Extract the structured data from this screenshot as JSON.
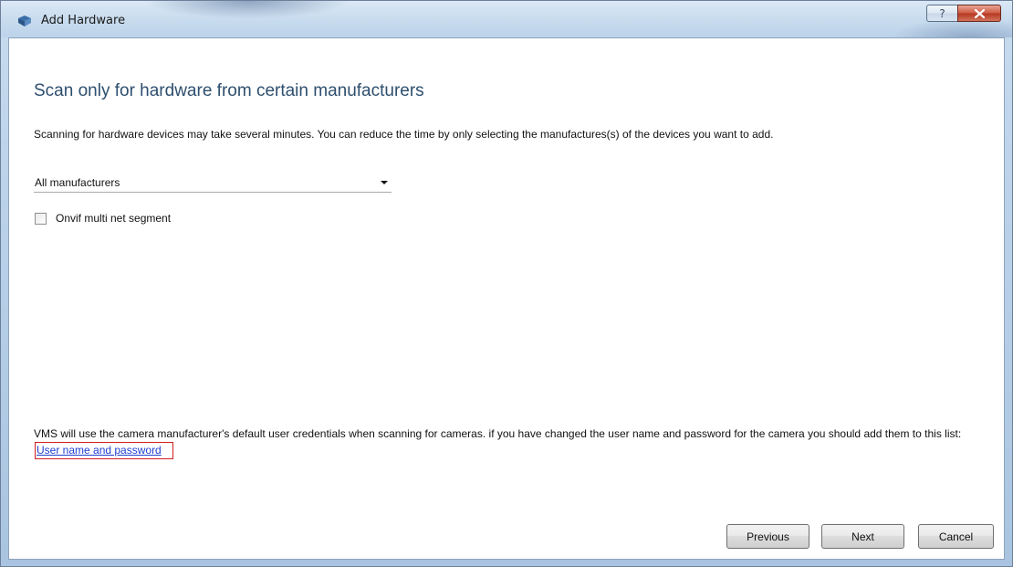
{
  "window": {
    "title": "Add Hardware",
    "icons": {
      "app": "add-hardware-icon",
      "help": "help-icon",
      "close": "close-icon"
    },
    "help_glyph": "?"
  },
  "heading": "Scan only for hardware from certain manufacturers",
  "intro": "Scanning for hardware devices may take several minutes. You can reduce the time by only selecting the manufactures(s) of the devices you want to add.",
  "manufacturer_select": {
    "value": "All manufacturers"
  },
  "onvif_checkbox": {
    "label": "Onvif multi net segment",
    "checked": false
  },
  "credentials_note": {
    "text": "VMS will use the camera manufacturer's default user credentials when scanning for cameras. if you have changed the user name and password for the camera you should add them to this list:",
    "link": "User name and password",
    "highlight_color": "#d11e1e"
  },
  "buttons": {
    "previous": "Previous",
    "next": "Next",
    "cancel": "Cancel"
  },
  "colors": {
    "heading": "#2e4f6e",
    "link": "#1f3fcf"
  }
}
